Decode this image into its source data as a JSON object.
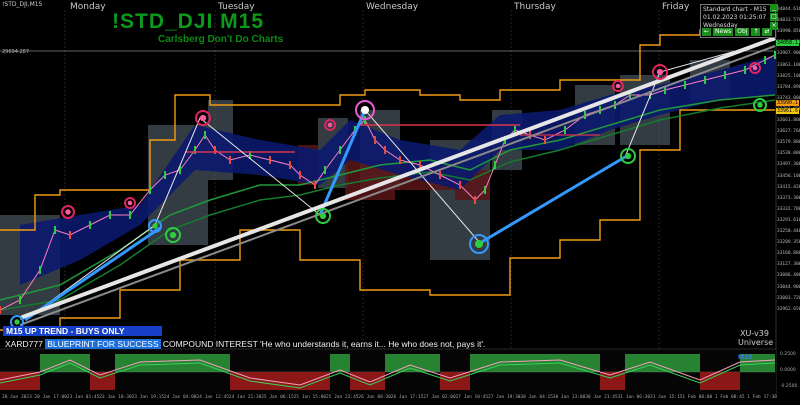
{
  "window_title": "!STD_DJI,M15",
  "symbol_title": "!STD_DJI M15",
  "subtitle": "Carlsberg Don't Do Charts",
  "days": [
    "Monday",
    "Tuesday",
    "Wednesday",
    "Thursday",
    "Friday"
  ],
  "info_panel": {
    "line1": "Standard chart - M15",
    "line2": "01.02.2023",
    "line3": "01:25:07",
    "line4": "Wednesday",
    "buttons": [
      "←",
      "News",
      "Obj",
      "↑",
      "⇄"
    ],
    "ctrl_buttons": [
      "_",
      "□",
      "×"
    ]
  },
  "hline_value": "29694.287",
  "price_scale": [
    "34044.616",
    "34033.570",
    "33990.850",
    "33949.120",
    "33907.900",
    "33863.100",
    "33825.100",
    "33784.890",
    "33743.000",
    "33702.880",
    "33661.800",
    "33627.760",
    "33579.880",
    "33538.000",
    "33497.300",
    "33456.100",
    "33415.420",
    "33373.300",
    "33332.700",
    "33291.610",
    "33250.440",
    "33209.350",
    "33168.880",
    "33127.300",
    "33086.400",
    "33044.900",
    "33003.720",
    "32962.650"
  ],
  "price_tags": {
    "current": "34058.1",
    "level_a": "33990.1",
    "level_b": "33961.6"
  },
  "trend_banner": "M15 UP TREND - BUYS ONLY",
  "bottom_line": {
    "name": "XARD777",
    "blueprint": "BLUEPRINT FOR SUCCESS",
    "quote": "COMPOUND INTEREST  'He who understands it, earns it... He who does not, pays it'."
  },
  "brand_1": "XU-v39",
  "brand_2": "Universe",
  "indicator_label": "M15",
  "time_labels": [
    "20 Jan 2023",
    "20 Jan 17:00",
    "23 Jan 01:45",
    "23 Jan 10:30",
    "23 Jan 19:15",
    "24 Jan 04:00",
    "24 Jan 12:45",
    "24 Jan 21:30",
    "25 Jan 06:15",
    "25 Jan 15:00",
    "25 Jan 23:45",
    "26 Jan 08:30",
    "26 Jan 17:15",
    "27 Jan 02:00",
    "27 Jan 10:45",
    "27 Jan 19:30",
    "30 Jan 04:15",
    "30 Jan 13:00",
    "30 Jan 21:45",
    "31 Jan 06:30",
    "31 Jan 15:15",
    "1 Feb 00:00",
    "1 Feb 08:45",
    "1 Feb 17:30"
  ],
  "indicator_scale": [
    "0.2500",
    "0.0000",
    "-0.2500"
  ],
  "colors": {
    "background": "#000000",
    "title": "#0c9a1a",
    "envelope": "#f39c12",
    "trend_band": "#0a1a6e",
    "cloud": "#55636f",
    "bull": "#2ecc40",
    "bear": "#c0392b",
    "banner": "#1640c8"
  }
}
